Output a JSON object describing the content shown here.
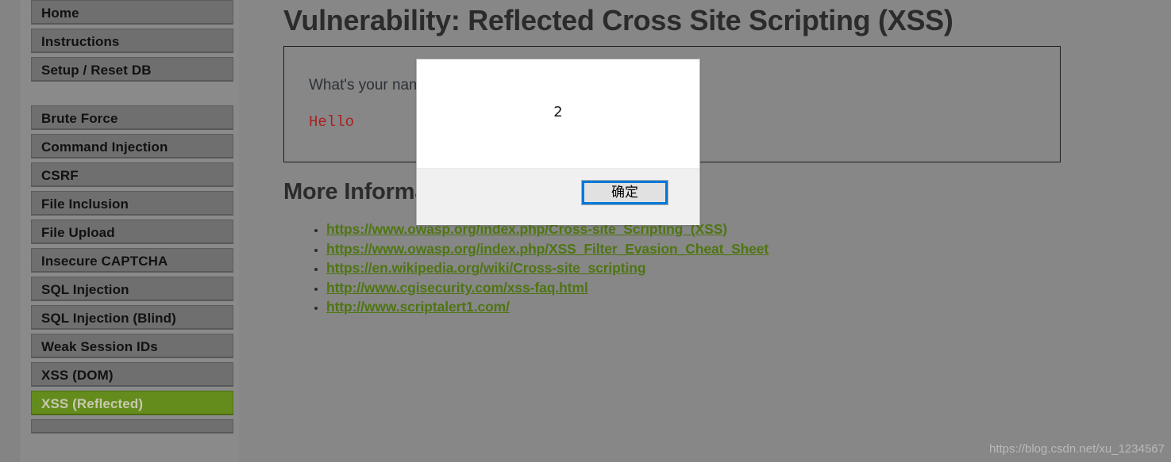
{
  "colors": {
    "page_background": "#878787",
    "sidebar_background": "#8a8a8a",
    "nav_item_background": "#6f6f6f",
    "nav_item_active_background": "#638c1c",
    "link_green": "#4f7512",
    "output_red": "#aa2222",
    "dialog_button_focus_blue": "#0078d7",
    "heading_color": "#2b2b2b"
  },
  "sidebar": {
    "groups": [
      {
        "items": [
          {
            "label": "Home",
            "active": false
          },
          {
            "label": "Instructions",
            "active": false
          },
          {
            "label": "Setup / Reset DB",
            "active": false
          }
        ]
      },
      {
        "items": [
          {
            "label": "Brute Force",
            "active": false
          },
          {
            "label": "Command Injection",
            "active": false
          },
          {
            "label": "CSRF",
            "active": false
          },
          {
            "label": "File Inclusion",
            "active": false
          },
          {
            "label": "File Upload",
            "active": false
          },
          {
            "label": "Insecure CAPTCHA",
            "active": false
          },
          {
            "label": "SQL Injection",
            "active": false
          },
          {
            "label": "SQL Injection (Blind)",
            "active": false
          },
          {
            "label": "Weak Session IDs",
            "active": false
          },
          {
            "label": "XSS (DOM)",
            "active": false
          },
          {
            "label": "XSS (Reflected)",
            "active": true
          },
          {
            "label": "",
            "active": false
          }
        ]
      }
    ]
  },
  "main": {
    "page_title": "Vulnerability: Reflected Cross Site Scripting (XSS)",
    "form": {
      "label": "What's your name?",
      "reflected_output": "Hello"
    },
    "more_information_heading": "More Information",
    "links": [
      "https://www.owasp.org/index.php/Cross-site_Scripting_(XSS)",
      "https://www.owasp.org/index.php/XSS_Filter_Evasion_Cheat_Sheet",
      "https://en.wikipedia.org/wiki/Cross-site_scripting",
      "http://www.cgisecurity.com/xss-faq.html",
      "http://www.scriptalert1.com/"
    ]
  },
  "alert_dialog": {
    "message": "2",
    "ok_label": "确定"
  },
  "watermark": {
    "text": "https://blog.csdn.net/xu_1234567"
  }
}
